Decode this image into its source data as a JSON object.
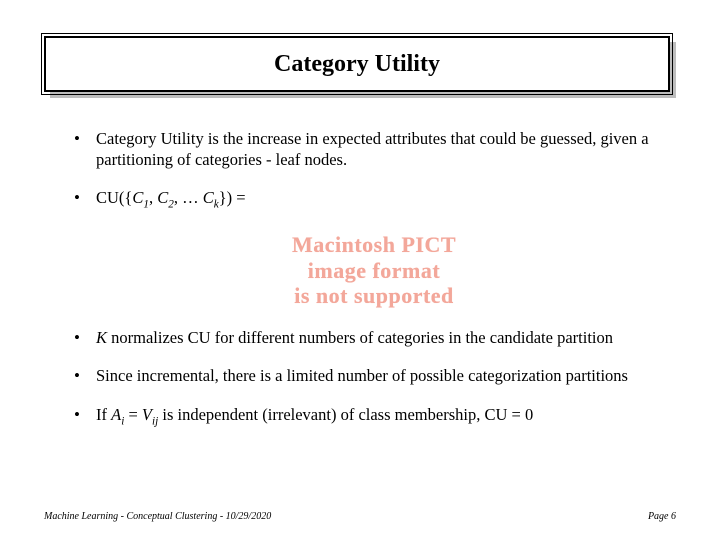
{
  "title": "Category Utility",
  "bullets": {
    "b1": "Category Utility is the increase in expected attributes that could be guessed, given a partitioning of categories - leaf nodes.",
    "b2_pre": "CU({",
    "b2_c1": "C",
    "b2_s1": "1",
    "b2_c2": "C",
    "b2_s2": "2",
    "b2_mid": ", … ",
    "b2_ck": "C",
    "b2_sk": "k",
    "b2_post": "}) =",
    "b3_pre_i": "K",
    "b3_rest": " normalizes CU for different numbers of categories in the candidate partition",
    "b4": "Since incremental, there is a limited number of possible categorization partitions",
    "b5_pre": "If ",
    "b5_A": "A",
    "b5_i": "i",
    "b5_eq": " = ",
    "b5_V": "V",
    "b5_ij": "ij",
    "b5_rest": " is independent (irrelevant) of class membership, CU = 0"
  },
  "pict": {
    "l1": "Macintosh PICT",
    "l2": "image format",
    "l3": "is not supported"
  },
  "footer": {
    "left": "Machine Learning -  Conceptual Clustering - 10/29/2020",
    "right": "Page 6"
  }
}
